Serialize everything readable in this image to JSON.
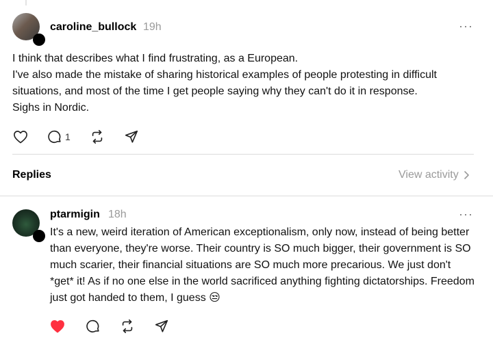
{
  "post": {
    "username": "caroline_bullock",
    "time": "19h",
    "more": "···",
    "text": "I think that describes what I find frustrating, as a European.\nI've also made the mistake of sharing historical examples of people protesting in difficult situations, and most of the time I get people saying why they can't do it in response.\nSighs in Nordic.",
    "reply_count": "1"
  },
  "replies_section": {
    "title": "Replies",
    "view_activity": "View activity"
  },
  "reply": {
    "username": "ptarmigin",
    "time": "18h",
    "more": "···",
    "text": "It's a new, weird iteration of American exceptionalism, only now, instead of being better than everyone, they're worse. Their country is SO much bigger, their government is SO much scarier, their financial situations are SO much more precarious. We just don't *get* it! As if no one else in the world sacrificed anything fighting dictatorships. Freedom just got handed to them, I guess 😒",
    "liked": true
  },
  "colors": {
    "like_active": "#ff3040",
    "muted": "#9a9a9a"
  },
  "icons": [
    "heart-icon",
    "comment-icon",
    "repost-icon",
    "share-icon",
    "chevron-right-icon",
    "more-icon",
    "follow-plus-icon"
  ]
}
